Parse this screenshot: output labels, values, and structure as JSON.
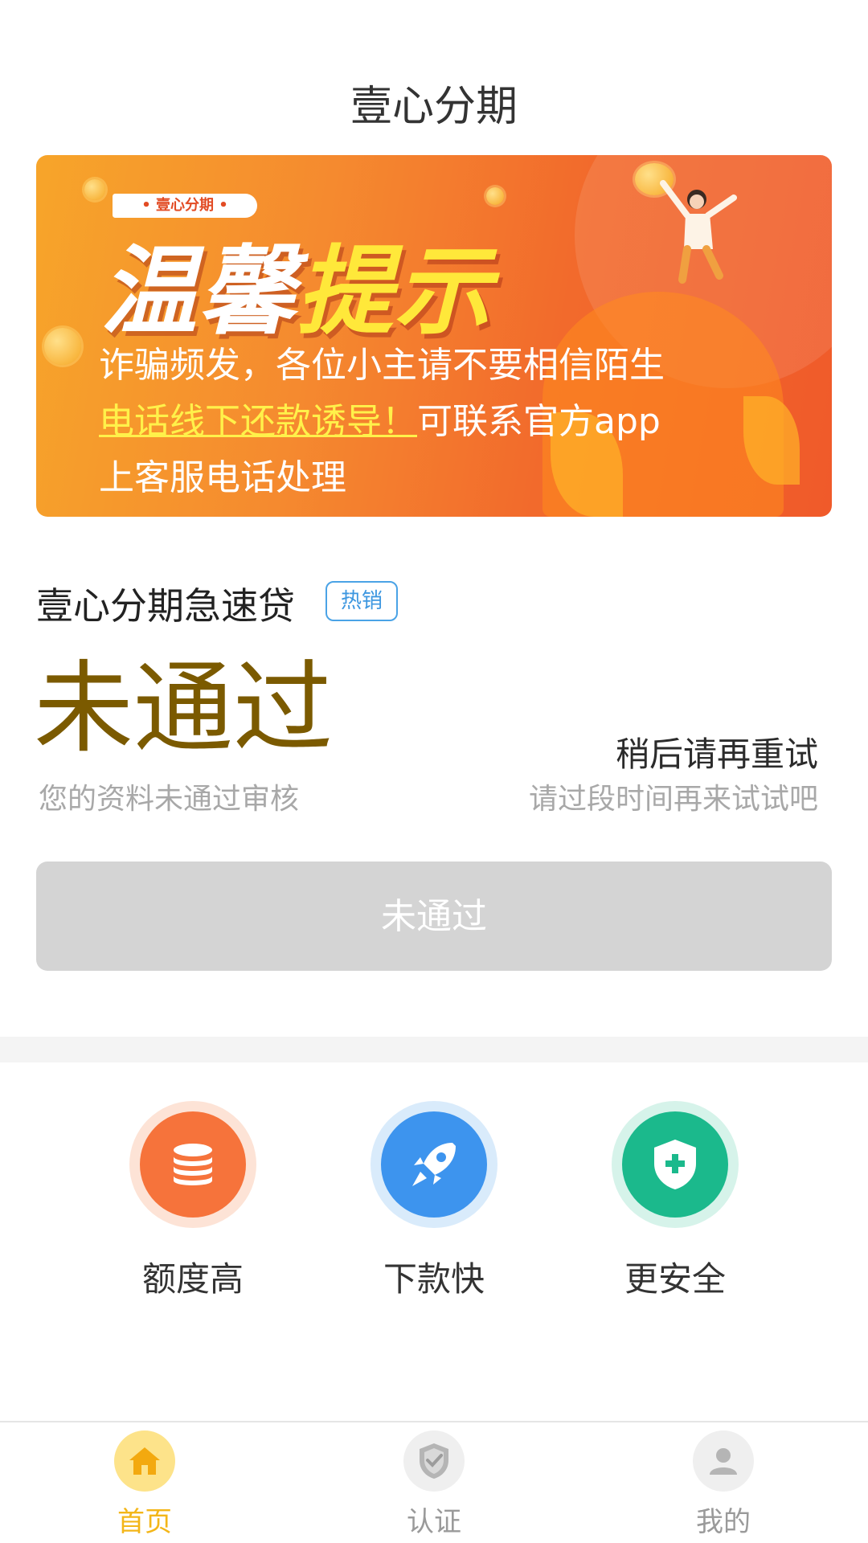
{
  "header": {
    "title": "壹心分期"
  },
  "banner": {
    "tag": "• 壹心分期 •",
    "headline_part1": "温馨",
    "headline_part2": "提示",
    "line1": "诈骗频发，各位小主请不要相信陌生",
    "line2_highlight": "电话线下还款诱导！",
    "line2_rest": "可联系官方app",
    "line3": "上客服电话处理"
  },
  "product": {
    "title": "壹心分期急速贷",
    "badge": "热销"
  },
  "status": {
    "main": "未通过",
    "main_desc": "您的资料未通过审核",
    "retry_title": "稍后请再重试",
    "retry_desc": "请过段时间再来试试吧"
  },
  "action_button": {
    "label": "未通过"
  },
  "features": [
    {
      "label": "额度高",
      "icon": "coin-stack-icon",
      "color": "#f6733b"
    },
    {
      "label": "下款快",
      "icon": "rocket-icon",
      "color": "#3d94ee"
    },
    {
      "label": "更安全",
      "icon": "shield-plus-icon",
      "color": "#1bb98c"
    }
  ],
  "bottom_nav": {
    "home": {
      "label": "首页",
      "icon": "home-icon",
      "active": true
    },
    "cert": {
      "label": "认证",
      "icon": "shield-check-icon",
      "active": false
    },
    "me": {
      "label": "我的",
      "icon": "user-icon",
      "active": false
    }
  },
  "colors": {
    "status_text": "#7b5a00",
    "badge_blue": "#3d97e0",
    "nav_active": "#f3b619",
    "button_disabled": "#d4d4d4"
  }
}
